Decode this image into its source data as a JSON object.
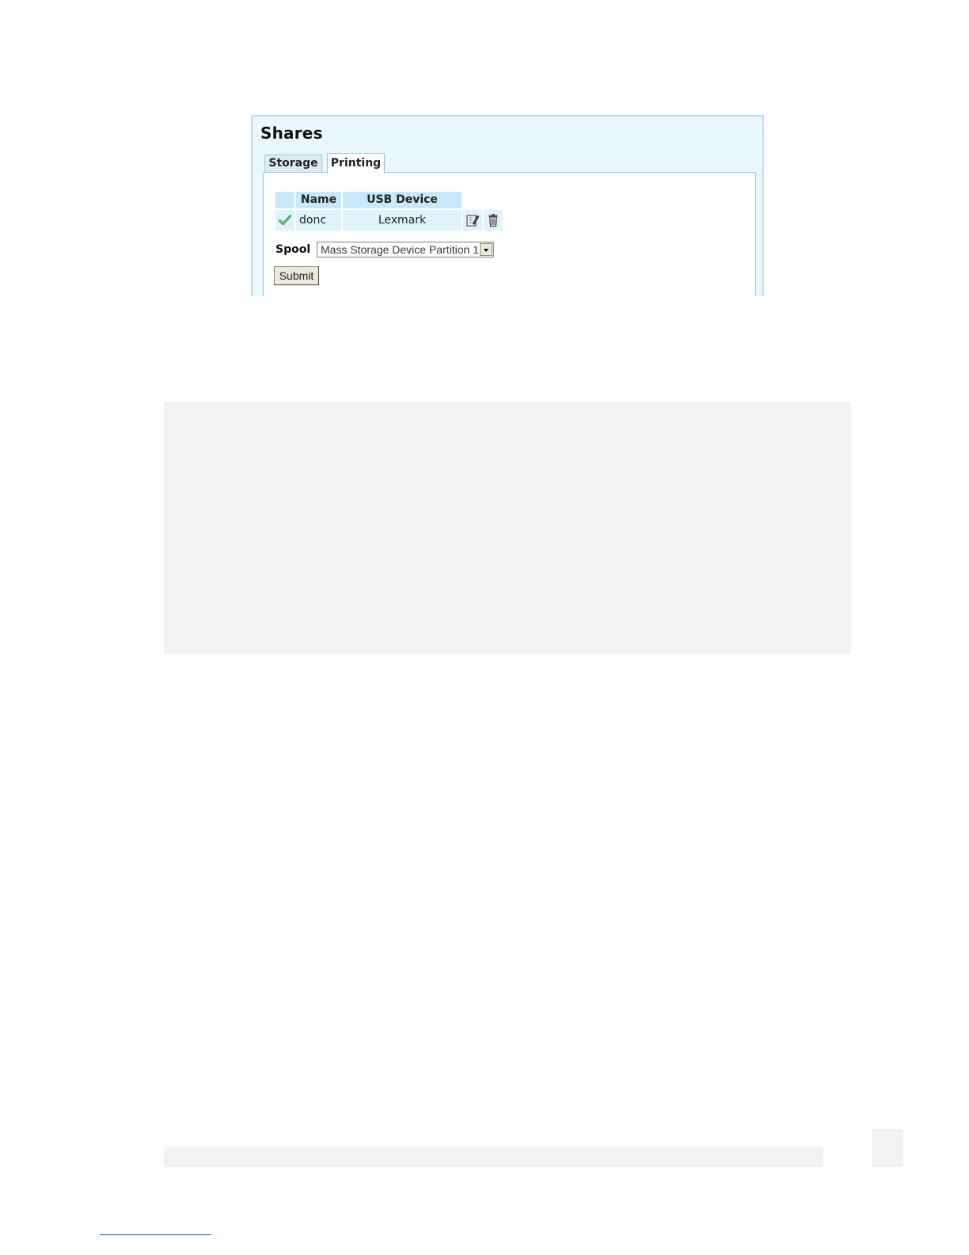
{
  "panel": {
    "title": "Shares",
    "tabs": [
      {
        "label": "Storage",
        "active": false
      },
      {
        "label": "Printing",
        "active": true
      }
    ]
  },
  "printers": {
    "columns": [
      "",
      "Name",
      "USB Device"
    ],
    "rows": [
      {
        "status_icon": "check-icon",
        "name": "donc",
        "usb_device": "Lexmark"
      }
    ]
  },
  "spool": {
    "label": "Spool",
    "selected": "Mass Storage Device Partition 1"
  },
  "submit_label": "Submit",
  "colors": {
    "panel_bg": "#e8f8fd",
    "header_bg": "#c8e9fb",
    "row_bg": "#dff3fd",
    "placeholder_gray": "#f2f2f2"
  }
}
